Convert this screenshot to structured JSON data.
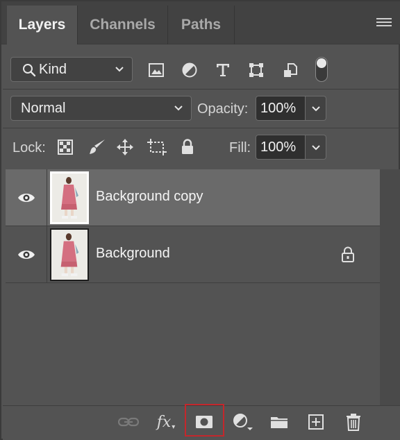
{
  "tabs": [
    {
      "label": "Layers",
      "active": true
    },
    {
      "label": "Channels",
      "active": false
    },
    {
      "label": "Paths",
      "active": false
    }
  ],
  "filter": {
    "kind_value": "Kind",
    "icons": [
      "pixel-filter-icon",
      "adjustment-filter-icon",
      "type-filter-icon",
      "shape-filter-icon",
      "smart-object-filter-icon"
    ]
  },
  "blending": {
    "mode": "Normal",
    "opacity_label": "Opacity:",
    "opacity_value": "100%"
  },
  "lock": {
    "label": "Lock:",
    "icons": [
      "lock-transparent-pixels-icon",
      "lock-image-pixels-icon",
      "lock-position-icon",
      "lock-artboard-icon",
      "lock-all-icon"
    ],
    "fill_label": "Fill:",
    "fill_value": "100%"
  },
  "layers": [
    {
      "name": "Background copy",
      "visible": true,
      "selected": true,
      "locked": false
    },
    {
      "name": "Background",
      "visible": true,
      "selected": false,
      "locked": true
    }
  ],
  "toolbar": {
    "fx_label": "fx",
    "icons": [
      "link-layers-icon",
      "layer-style-icon",
      "add-mask-icon",
      "adjustment-layer-icon",
      "group-folder-icon",
      "new-layer-icon",
      "delete-layer-icon"
    ],
    "highlighted": "add-mask-icon",
    "highlight_color": "#c4272c"
  },
  "colors": {
    "panel_bg": "#535353",
    "tab_bar_bg": "#424242",
    "selected_row_bg": "#6a6a6a"
  }
}
